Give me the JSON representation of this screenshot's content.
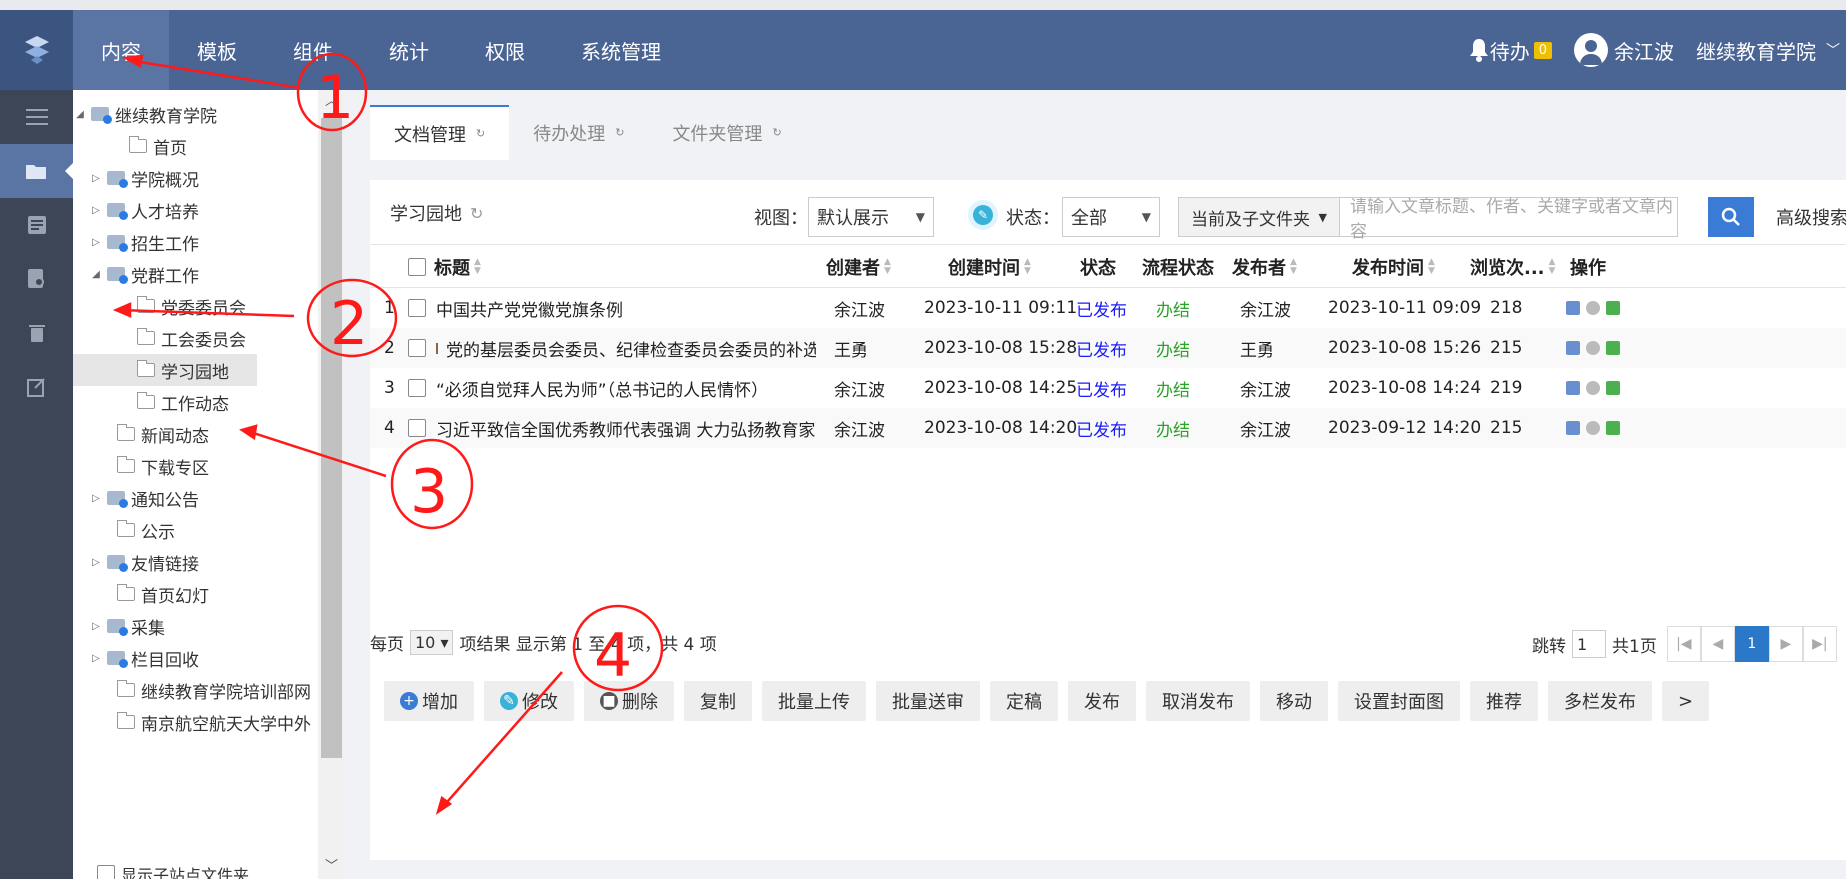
{
  "header": {
    "nav": [
      "内容",
      "模板",
      "组件",
      "统计",
      "权限",
      "系统管理"
    ],
    "todo_label": "待办",
    "todo_count": "0",
    "user_name": "余江波",
    "org_name": "继续教育学院"
  },
  "tree": {
    "items": [
      {
        "label": "继续教育学院",
        "toggle": "◢",
        "icon": "site"
      },
      {
        "label": "首页",
        "toggle": "",
        "icon": "folder"
      },
      {
        "label": "学院概况",
        "toggle": "▷",
        "icon": "site"
      },
      {
        "label": "人才培养",
        "toggle": "▷",
        "icon": "site"
      },
      {
        "label": "招生工作",
        "toggle": "▷",
        "icon": "site"
      },
      {
        "label": "党群工作",
        "toggle": "◢",
        "icon": "site"
      },
      {
        "label": "党委委员会",
        "toggle": "",
        "icon": "folder"
      },
      {
        "label": "工会委员会",
        "toggle": "",
        "icon": "folder"
      },
      {
        "label": "学习园地",
        "toggle": "",
        "icon": "folder"
      },
      {
        "label": "工作动态",
        "toggle": "",
        "icon": "folder"
      },
      {
        "label": "新闻动态",
        "toggle": "",
        "icon": "folder"
      },
      {
        "label": "下载专区",
        "toggle": "",
        "icon": "folder"
      },
      {
        "label": "通知公告",
        "toggle": "▷",
        "icon": "site"
      },
      {
        "label": "公示",
        "toggle": "",
        "icon": "folder"
      },
      {
        "label": "友情链接",
        "toggle": "▷",
        "icon": "site"
      },
      {
        "label": "首页幻灯",
        "toggle": "",
        "icon": "folder"
      },
      {
        "label": "采集",
        "toggle": "▷",
        "icon": "site"
      },
      {
        "label": "栏目回收",
        "toggle": "▷",
        "icon": "site"
      },
      {
        "label": "继续教育学院培训部网",
        "toggle": "",
        "icon": "folder"
      },
      {
        "label": "南京航空航天大学中外",
        "toggle": "",
        "icon": "folder"
      }
    ],
    "show_subsites": "显示子站点文件夹"
  },
  "tabs": [
    {
      "label": "文档管理"
    },
    {
      "label": "待办处理"
    },
    {
      "label": "文件夹管理"
    }
  ],
  "main": {
    "folder_title": "学习园地",
    "view_label": "视图：",
    "view_value": "默认展示",
    "status_label": "状态：",
    "status_value": "全部",
    "scope_value": "当前及子文件夹",
    "search_placeholder": "请输入文章标题、作者、关键字或者文章内容",
    "advanced_search": "高级搜索"
  },
  "table": {
    "headers": [
      "标题",
      "创建者",
      "创建时间",
      "状态",
      "流程状态",
      "发布者",
      "发布时间",
      "浏览次...",
      "操作"
    ],
    "rows": [
      {
        "no": "1",
        "title": "中国共产党党徽党旗条例",
        "creator": "余江波",
        "created": "2023-10-11 09:11",
        "status": "已发布",
        "flow": "办结",
        "publisher": "余江波",
        "published": "2023-10-11 09:09",
        "views": "218"
      },
      {
        "no": "2",
        "title": "党的基层委员会委员、纪律检查委员会委员的补选...",
        "creator": "王勇",
        "created": "2023-10-08 15:28",
        "status": "已发布",
        "flow": "办结",
        "publisher": "王勇",
        "published": "2023-10-08 15:26",
        "views": "215"
      },
      {
        "no": "3",
        "title": "“必须自觉拜人民为师”（总书记的人民情怀）",
        "creator": "余江波",
        "created": "2023-10-08 14:25",
        "status": "已发布",
        "flow": "办结",
        "publisher": "余江波",
        "published": "2023-10-08 14:24",
        "views": "219"
      },
      {
        "no": "4",
        "title": "习近平致信全国优秀教师代表强调 大力弘扬教育家精...",
        "creator": "余江波",
        "created": "2023-10-08 14:20",
        "status": "已发布",
        "flow": "办结",
        "publisher": "余江波",
        "published": "2023-09-12 14:20",
        "views": "215"
      }
    ]
  },
  "pager": {
    "per_page_label": "每页",
    "per_page": "10",
    "summary": "项结果 显示第 1 至 4 项，共 4 项",
    "jump_label": "跳转",
    "jump_value": "1",
    "total_pages": "共1页",
    "current": "1"
  },
  "toolbar": [
    "增加",
    "修改",
    "删除",
    "复制",
    "批量上传",
    "批量送审",
    "定稿",
    "发布",
    "取消发布",
    "移动",
    "设置封面图",
    "推荐",
    "多栏发布",
    ">"
  ],
  "annotations": [
    "1",
    "2",
    "3",
    "4"
  ]
}
